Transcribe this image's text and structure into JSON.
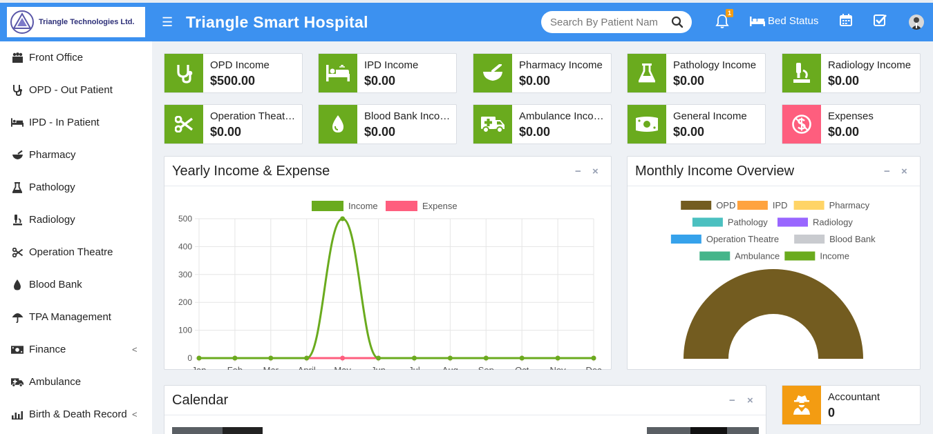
{
  "logo": {
    "text": "Triangle Technologies Ltd."
  },
  "header": {
    "title": "Triangle Smart Hospital",
    "search_placeholder": "Search By Patient Name",
    "notification_count": "1",
    "bed_status_label": "Bed Status",
    "icons": [
      "menu-icon",
      "search-icon",
      "bell-icon",
      "bed-icon",
      "calendar-icon",
      "checkbox-icon",
      "avatar"
    ]
  },
  "sidebar": {
    "items": [
      {
        "label": "Front Office",
        "icon": "front-office-icon"
      },
      {
        "label": "OPD - Out Patient",
        "icon": "stethoscope-icon"
      },
      {
        "label": "IPD - In Patient",
        "icon": "bed-icon"
      },
      {
        "label": "Pharmacy",
        "icon": "mortar-pestle-icon"
      },
      {
        "label": "Pathology",
        "icon": "flask-icon"
      },
      {
        "label": "Radiology",
        "icon": "microscope-icon"
      },
      {
        "label": "Operation Theatre",
        "icon": "scissors-icon"
      },
      {
        "label": "Blood Bank",
        "icon": "tint-icon"
      },
      {
        "label": "TPA Management",
        "icon": "umbrella-icon"
      },
      {
        "label": "Finance",
        "icon": "money-icon",
        "chevron": "<"
      },
      {
        "label": "Ambulance",
        "icon": "ambulance-icon"
      },
      {
        "label": "Birth & Death Record",
        "icon": "bars-icon",
        "chevron": "<"
      }
    ]
  },
  "income_boxes": [
    {
      "label": "OPD Income",
      "value": "$500.00",
      "icon": "stethoscope-icon"
    },
    {
      "label": "IPD Income",
      "value": "$0.00",
      "icon": "bed-icon"
    },
    {
      "label": "Pharmacy Income",
      "value": "$0.00",
      "icon": "mortar-pestle-icon"
    },
    {
      "label": "Pathology Income",
      "value": "$0.00",
      "icon": "flask-icon"
    },
    {
      "label": "Radiology Income",
      "value": "$0.00",
      "icon": "microscope-icon"
    },
    {
      "label": "Operation Theatre Income",
      "value": "$0.00",
      "icon": "scissors-icon"
    },
    {
      "label": "Blood Bank Income",
      "value": "$0.00",
      "icon": "tint-icon"
    },
    {
      "label": "Ambulance Income",
      "value": "$0.00",
      "icon": "ambulance-icon"
    },
    {
      "label": "General Income",
      "value": "$0.00",
      "icon": "money-icon"
    },
    {
      "label": "Expenses",
      "value": "$0.00",
      "icon": "expense-icon"
    }
  ],
  "colors": {
    "green": "#6aab1e",
    "red": "#fe5e7e",
    "blue": "#3c91f0",
    "orange": "#f39c12"
  },
  "yearly_panel": {
    "title": "Yearly Income & Expense",
    "minimize": "−",
    "close": "×"
  },
  "monthly_panel": {
    "title": "Monthly Income Overview",
    "minimize": "−",
    "close": "×",
    "legend": [
      {
        "name": "OPD",
        "color": "#735c20"
      },
      {
        "name": "IPD",
        "color": "#ffa33f"
      },
      {
        "name": "Pharmacy",
        "color": "#ffd466"
      },
      {
        "name": "Pathology",
        "color": "#4bc0c0"
      },
      {
        "name": "Radiology",
        "color": "#9966ff"
      },
      {
        "name": "Operation Theatre",
        "color": "#36a2eb"
      },
      {
        "name": "Blood Bank",
        "color": "#c9cbcf"
      },
      {
        "name": "Ambulance",
        "color": "#45b58a"
      },
      {
        "name": "Income",
        "color": "#6aab1e"
      }
    ]
  },
  "calendar_panel": {
    "title": "Calendar",
    "minimize": "−",
    "close": "×"
  },
  "accountant": {
    "label": "Accountant",
    "value": "0",
    "icon": "user-secret-icon"
  },
  "chart_data": [
    {
      "type": "line",
      "title": "Yearly Income & Expense",
      "categories": [
        "Jan",
        "Feb",
        "Mar",
        "April",
        "May",
        "Jun",
        "Jul",
        "Aug",
        "Sep",
        "Oct",
        "Nov",
        "Dec"
      ],
      "series": [
        {
          "name": "Income",
          "color": "#6aab1e",
          "values": [
            0,
            0,
            0,
            0,
            500,
            0,
            0,
            0,
            0,
            0,
            0,
            0
          ]
        },
        {
          "name": "Expense",
          "color": "#fe5e7e",
          "values": [
            0,
            0,
            0,
            0,
            0,
            0,
            0,
            0,
            0,
            0,
            0,
            0
          ]
        }
      ],
      "ylim": [
        0,
        500
      ],
      "yticks": [
        0,
        100,
        200,
        300,
        400,
        500
      ],
      "grid": true,
      "legend": "top"
    },
    {
      "type": "pie",
      "title": "Monthly Income Overview",
      "variant": "half-doughnut",
      "labels": [
        "OPD",
        "IPD",
        "Pharmacy",
        "Pathology",
        "Radiology",
        "Operation Theatre",
        "Blood Bank",
        "Ambulance",
        "Income"
      ],
      "values": [
        500,
        0,
        0,
        0,
        0,
        0,
        0,
        0,
        0
      ],
      "legend": "top"
    }
  ]
}
